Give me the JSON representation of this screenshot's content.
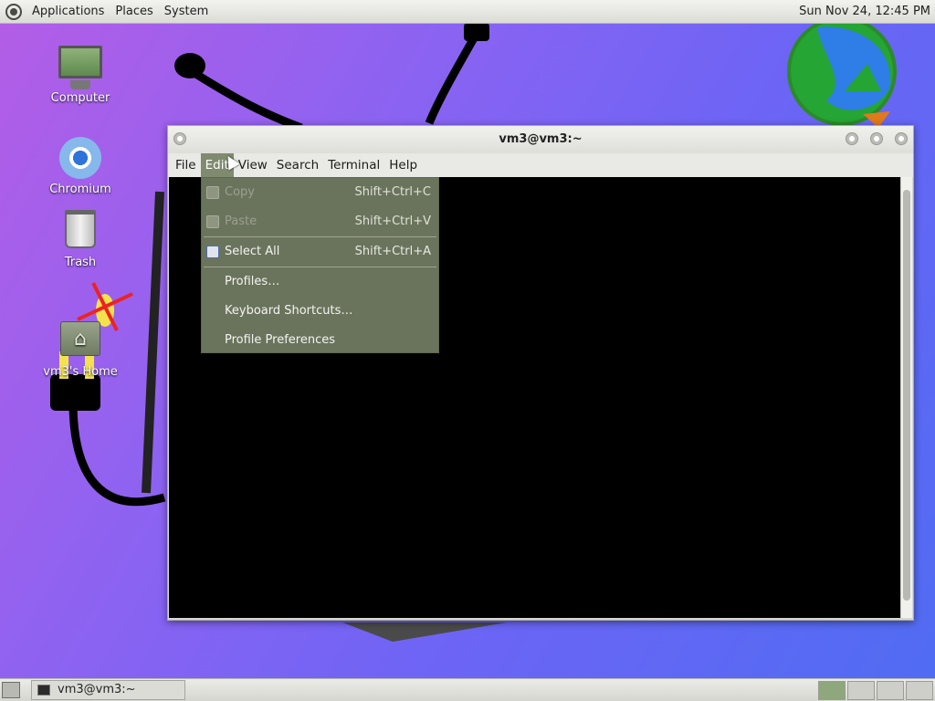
{
  "top_panel": {
    "menus": [
      "Applications",
      "Places",
      "System"
    ],
    "clock": "Sun Nov 24, 12:45 PM"
  },
  "desktop_icons": {
    "computer": "Computer",
    "chromium": "Chromium",
    "trash": "Trash",
    "home": "vm3's Home"
  },
  "window": {
    "title": "vm3@vm3:~",
    "menus": [
      "File",
      "Edit",
      "View",
      "Search",
      "Terminal",
      "Help"
    ],
    "active_menu": "Edit"
  },
  "edit_menu": {
    "items": [
      {
        "label": "Copy",
        "shortcut": "Shift+Ctrl+C",
        "enabled": false,
        "icon": "copy-icon"
      },
      {
        "label": "Paste",
        "shortcut": "Shift+Ctrl+V",
        "enabled": false,
        "icon": "paste-icon"
      },
      {
        "label": "Select All",
        "shortcut": "Shift+Ctrl+A",
        "enabled": true,
        "icon": "select-all-icon"
      },
      {
        "label": "Profiles…",
        "shortcut": "",
        "enabled": true
      },
      {
        "label": "Keyboard Shortcuts…",
        "shortcut": "",
        "enabled": true
      },
      {
        "label": "Profile Preferences",
        "shortcut": "",
        "enabled": true
      }
    ]
  },
  "taskbar": {
    "task_label": "vm3@vm3:~",
    "workspaces": 4,
    "active_workspace": 1
  },
  "colors": {
    "menu_bg": "#707a62",
    "active_menu": "#7f8a6e",
    "terminal_bg": "#000000"
  }
}
